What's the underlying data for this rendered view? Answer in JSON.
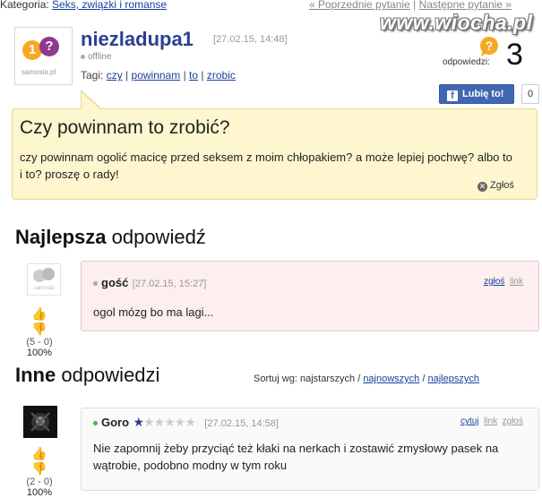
{
  "topbar": {
    "category_prefix": "Kategoria:",
    "category_link": "Seks, związki i romanse",
    "prev_link": "« Poprzednie pytanie",
    "separator": "|",
    "next_link": "Następne pytanie »"
  },
  "watermark": "www.wiocha.pl",
  "logo": {
    "bubble1": "1",
    "bubble2": "?",
    "text": "samosia.pl"
  },
  "question": {
    "username": "niezladupa1",
    "date": "[27.02.15, 14:48]",
    "status": "offline",
    "tags_label": "Tagi:",
    "tags": [
      "czy",
      "powinnam",
      "to",
      "zrobic"
    ],
    "tag_sep": "|",
    "answers_label": "odpowiedzi:",
    "answers_count": "3",
    "title": "Czy powinnam to zrobić?",
    "body": "czy powinnam ogolić macicę przed seksem z moim chłopakiem? a może lepiej pochwę? albo to i to? proszę o rady!",
    "report": "Zgłoś"
  },
  "facebook": {
    "label": "Lubię to!",
    "count": "0"
  },
  "best_section": {
    "bold": "Najlepsza",
    "rest": " odpowiedź"
  },
  "best_answer": {
    "user": "gość",
    "date": "[27.02.15, 15:27]",
    "link_report": "zgłoś",
    "link_link": "link",
    "text": "ogol mózg bo ma lagi...",
    "votes": "(5 - 0)",
    "percent": "100%",
    "status_color": "#aaaaaa"
  },
  "other_section": {
    "bold": "Inne",
    "rest": " odpowiedzi"
  },
  "sort": {
    "label": "Sortuj wg:",
    "oldest": "najstarszych",
    "newest": "najnowszych",
    "best": "najlepszych",
    "sep": "/"
  },
  "other_answer": {
    "user": "Goro",
    "rating": 1,
    "rating_max": 6,
    "date": "[27.02.15, 14:58]",
    "link_quote": "cytuj",
    "link_link": "link",
    "link_report": "zgłoś",
    "text": "Nie zapomnij żeby przyciąć też kłaki na nerkach i zostawić zmysłowy pasek na wątrobie, podobno modny w tym roku",
    "votes": "(2 - 0)",
    "percent": "100%",
    "status_color": "#4caf50"
  },
  "colors": {
    "accent": "#2b3f8e",
    "question_bg": "#fdf6cf",
    "best_bg": "#fdeef0",
    "logo_orange": "#f7a823",
    "logo_purple": "#8e3a8e"
  }
}
